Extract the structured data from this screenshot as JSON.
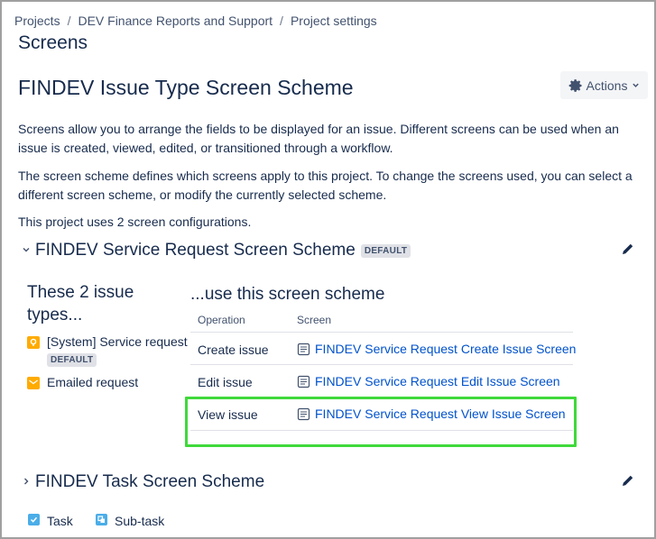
{
  "breadcrumb": {
    "items": [
      "Projects",
      "DEV Finance Reports and Support",
      "Project settings"
    ],
    "separator": "/"
  },
  "page": {
    "section_title": "Screens",
    "title": "FINDEV Issue Type Screen Scheme",
    "actions_label": "Actions"
  },
  "description": {
    "p1": "Screens allow you to arrange the fields to be displayed for an issue. Different screens can be used when an issue is created, viewed, edited, or transitioned through a workflow.",
    "p2": "The screen scheme defines which screens apply to this project. To change the screens used, you can select a different screen scheme, or modify the currently selected scheme.",
    "p3": "This project uses 2 screen configurations."
  },
  "scheme1": {
    "name": "FINDEV Service Request Screen Scheme",
    "badge": "DEFAULT",
    "issue_types_heading": "These 2 issue types...",
    "use_heading": "...use this screen scheme",
    "issue_types": [
      {
        "name": "[System] Service request",
        "badge": "DEFAULT",
        "icon": "service-request-icon"
      },
      {
        "name": "Emailed request",
        "icon": "email-icon"
      }
    ],
    "table": {
      "col_operation": "Operation",
      "col_screen": "Screen",
      "rows": [
        {
          "operation": "Create issue",
          "screen": "FINDEV Service Request Create Issue Screen"
        },
        {
          "operation": "Edit issue",
          "screen": "FINDEV Service Request Edit Issue Screen"
        },
        {
          "operation": "View issue",
          "screen": "FINDEV Service Request View Issue Screen"
        }
      ]
    }
  },
  "scheme2": {
    "name": "FINDEV Task Screen Scheme",
    "issue_types": [
      {
        "name": "Task",
        "icon": "task-icon"
      },
      {
        "name": "Sub-task",
        "icon": "subtask-icon"
      }
    ]
  },
  "colors": {
    "link": "#0052cc",
    "highlight": "#3fd93a",
    "service_request_icon": "#ffab00",
    "email_icon": "#ffab00",
    "task_icon": "#4bade8"
  }
}
